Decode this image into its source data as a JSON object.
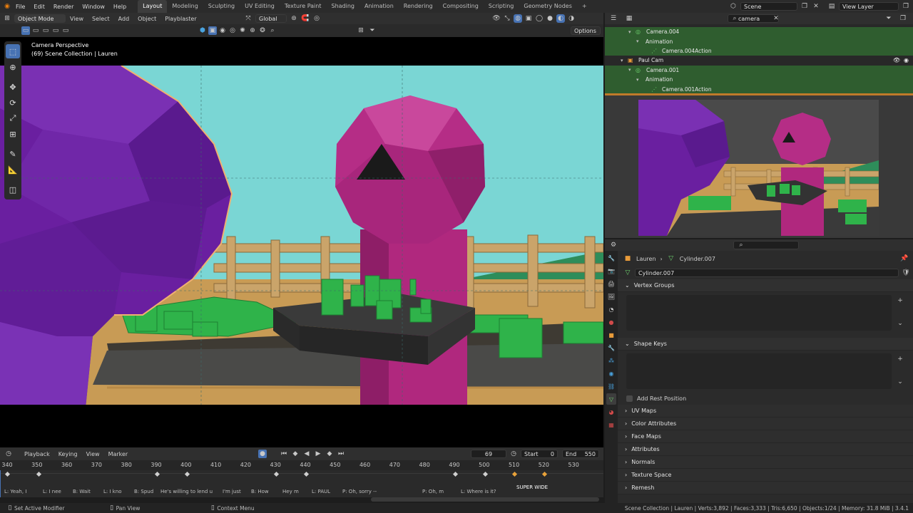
{
  "topbar": {
    "menus": [
      "File",
      "Edit",
      "Render",
      "Window",
      "Help"
    ],
    "workspaces": [
      "Layout",
      "Modeling",
      "Sculpting",
      "UV Editing",
      "Texture Paint",
      "Shading",
      "Animation",
      "Rendering",
      "Compositing",
      "Scripting",
      "Geometry Nodes"
    ],
    "active_workspace": "Layout",
    "add_tab": "+",
    "scene_label": "Scene",
    "view_layer_label": "View Layer"
  },
  "viewport_header": {
    "mode": "Object Mode",
    "menus": [
      "View",
      "Select",
      "Add",
      "Object",
      "Playblaster"
    ],
    "orientation": "Global",
    "options_label": "Options"
  },
  "viewport": {
    "overlay_line1": "Camera Perspective",
    "overlay_line2": "(69) Scene Collection | Lauren"
  },
  "outliner": {
    "search_value": "camera",
    "rows": [
      {
        "label": "Camera.004",
        "indent": 3,
        "icon": "camera-object-icon",
        "selected": true
      },
      {
        "label": "Animation",
        "indent": 4,
        "icon": "",
        "selected": true
      },
      {
        "label": "Camera.004Action",
        "indent": 5,
        "icon": "action-icon",
        "selected": true
      },
      {
        "label": "Paul Cam",
        "indent": 2,
        "icon": "collection-icon",
        "selected": false
      },
      {
        "label": "Camera.001",
        "indent": 3,
        "icon": "camera-object-icon",
        "selected": true
      },
      {
        "label": "Animation",
        "indent": 4,
        "icon": "",
        "selected": true
      },
      {
        "label": "Camera.001Action",
        "indent": 5,
        "icon": "action-icon",
        "selected": true
      }
    ]
  },
  "properties": {
    "breadcrumb_object": "Lauren",
    "breadcrumb_mesh": "Cylinder.007",
    "datablock_name": "Cylinder.007",
    "panels": {
      "vertex_groups": "Vertex Groups",
      "shape_keys": "Shape Keys",
      "add_rest_position": "Add Rest Position",
      "collapsed": [
        "UV Maps",
        "Color Attributes",
        "Face Maps",
        "Attributes",
        "Normals",
        "Texture Space",
        "Remesh"
      ]
    }
  },
  "timeline": {
    "menus": [
      "Playback",
      "Keying",
      "View",
      "Marker"
    ],
    "current_frame": "69",
    "start_label": "Start",
    "start_value": "0",
    "end_label": "End",
    "end_value": "550",
    "ticks": [
      "340",
      "350",
      "360",
      "370",
      "380",
      "390",
      "400",
      "410",
      "420",
      "430",
      "440",
      "450",
      "460",
      "470",
      "480",
      "490",
      "500",
      "510",
      "520",
      "530"
    ],
    "markers": [
      "L: Yeah, I",
      "L: I nee",
      "B: Wait",
      "L: I kno",
      "B: Spud",
      "He's willing to lend u",
      "I'm just",
      "B: How",
      "Hey m",
      "L: PAUL",
      "P: Oh, sorry --",
      "P: Oh, m",
      "L: Where is it?",
      "SUPER WIDE"
    ]
  },
  "statusbar": {
    "left_hint": "Set Active Modifier",
    "mid_hint": "Pan View",
    "right_hint": "Context Menu",
    "stats": "Scene Collection | Lauren | Verts:3,892 | Faces:3,333 | Tris:6,650 | Objects:1/24 | Memory: 31.8 MiB | 3.4.1"
  },
  "colors": {
    "accent": "#4772b3",
    "sky": "#7ad6d4",
    "puppet_purple": "#6a1fa0",
    "puppet_magenta": "#b0287e",
    "grass": "#2fb34a",
    "fence": "#caa46a",
    "tray": "#3a3a3a",
    "outliner_selected": "#2f5d2f"
  }
}
